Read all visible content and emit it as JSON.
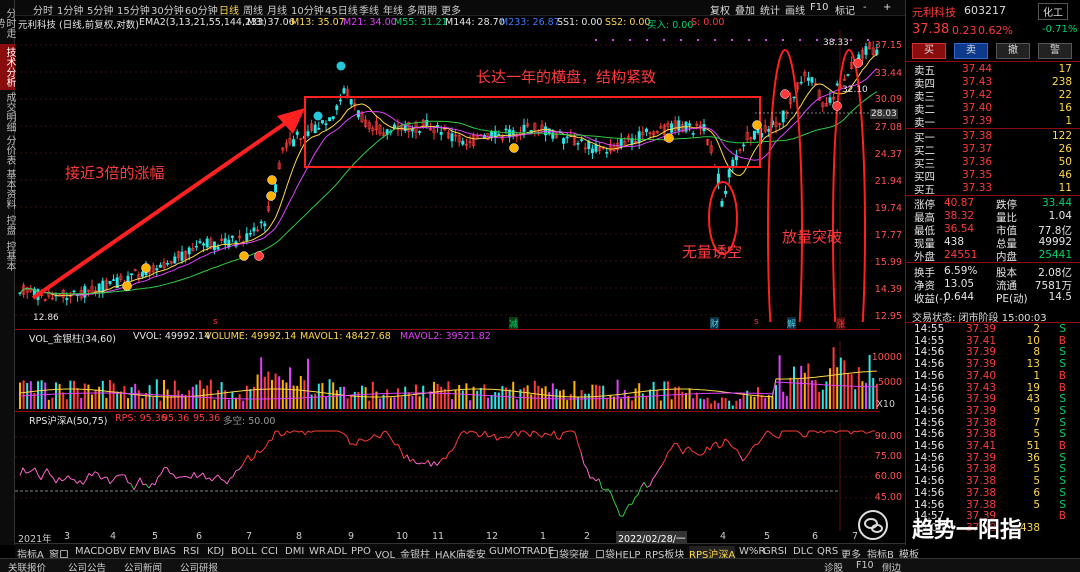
{
  "left_tabs": [
    "分时走势",
    "技术分析",
    "成交明细",
    "分价表",
    "基本资料",
    "控盘",
    "控基本"
  ],
  "toolbar": {
    "periods": [
      "分时",
      "1分钟",
      "5分钟",
      "15分钟",
      "30分钟",
      "60分钟",
      "日线",
      "周线",
      "月线",
      "10分钟",
      "45日线",
      "季线",
      "年线",
      "多周期",
      "更多"
    ],
    "right_items": [
      "复权",
      "叠加",
      "统计",
      "画线",
      "F10",
      "标记",
      "-",
      "+"
    ]
  },
  "main_header": {
    "stock": "元利科技 (日线,前复权,对数)",
    "ema": "EMA2(3,13,21,55,144,233)",
    "m3": "M3: 37.06",
    "m13": "M13: 35.07",
    "m21": "M21: 34.00",
    "m55": "M55: 31.21",
    "m144": "M144: 28.70",
    "m233": "M233: 26.87",
    "ss1": "SS1: 0.00",
    "ss2": "SS2: 0.00",
    "buy": "买入: 0.00",
    "s": "S: 0.00"
  },
  "price_axis": [
    "37.15",
    "33.44",
    "30.09",
    "27.08",
    "24.37",
    "21.94",
    "19.74",
    "17.77",
    "15.99",
    "14.39",
    "12.95"
  ],
  "price_labels": {
    "high": "38.33",
    "mid": "32.10",
    "current": "28.03",
    "low": "12.86"
  },
  "annotations": {
    "rally": "接近3倍的涨幅",
    "range": "长达一年的横盘，结构紧致",
    "dip": "无量诱空",
    "breakout": "放量突破"
  },
  "markers": [
    "s",
    "减",
    "财",
    "s",
    "解",
    "涨"
  ],
  "vol_header": {
    "name": "VOL_金银柱(34,60)",
    "vvol": "VVOL: 49992.14",
    "volume": "VOLUME: 49992.14",
    "mavol1": "MAVOL1: 48427.68",
    "mavol2": "MAVOL2: 39521.82"
  },
  "vol_axis": [
    "10000",
    "5000",
    "X10"
  ],
  "rps_header": {
    "name": "RPS沪深A(50,75)",
    "rps": "RPS: 95.36",
    "rps2": "95.36",
    "rps3": "95.36",
    "extra": "多空: 50.00"
  },
  "rps_axis": [
    "90.00",
    "75.00",
    "60.00",
    "45.00"
  ],
  "x_axis": [
    "2021年",
    "3",
    "4",
    "5",
    "6",
    "7",
    "8",
    "9",
    "10",
    "11",
    "12",
    "1",
    "2",
    "3",
    "4",
    "5",
    "6",
    "7"
  ],
  "x_date_highlight": "2022/02/28/一",
  "indicator_tabs": [
    "指标A",
    "窗口",
    "MACD",
    "OBV",
    "EMV",
    "BIAS",
    "RSI",
    "KDJ",
    "BOLL",
    "CCI",
    "DMI",
    "WR",
    "ADL",
    "PPO",
    "VOL_金银柱",
    "HAK庙委安",
    "GUMOTRADE",
    "口袋突破",
    "口袋HELP",
    "RPS板块",
    "RPS沪深A",
    "W%R",
    "GRSI",
    "DLC",
    "QRS",
    "更多",
    "指标B",
    "模板"
  ],
  "status_bar": [
    "关联报价",
    "公司公告",
    "公司新闻",
    "公司研报"
  ],
  "status_right": [
    "诊股",
    "F10",
    "侧边"
  ],
  "quote": {
    "name": "元利科技",
    "code": "603217",
    "sector": "化工",
    "sector_chg": "-0.71%",
    "price": "37.38",
    "change": "0.23",
    "pct": "0.62%",
    "buttons": [
      "买",
      "卖",
      "撤",
      "警"
    ],
    "asks": [
      [
        "卖五",
        "37.44",
        "17"
      ],
      [
        "卖四",
        "37.43",
        "238"
      ],
      [
        "卖三",
        "37.42",
        "22"
      ],
      [
        "卖二",
        "37.40",
        "16"
      ],
      [
        "卖一",
        "37.39",
        "1"
      ]
    ],
    "bids": [
      [
        "买一",
        "37.38",
        "122"
      ],
      [
        "买二",
        "37.37",
        "26"
      ],
      [
        "买三",
        "37.36",
        "50"
      ],
      [
        "买四",
        "37.35",
        "46"
      ],
      [
        "买五",
        "37.33",
        "11"
      ]
    ],
    "stats": [
      [
        "涨停",
        "40.87",
        "跌停",
        "33.44"
      ],
      [
        "最高",
        "38.32",
        "量比",
        "1.04"
      ],
      [
        "最低",
        "36.54",
        "市值",
        "77.8亿"
      ],
      [
        "现量",
        "438",
        "总量",
        "49992"
      ],
      [
        "外盘",
        "24551",
        "内盘",
        "25441"
      ],
      [
        "换手",
        "6.59%",
        "股本",
        "2.08亿"
      ],
      [
        "净资",
        "13.05",
        "流通",
        "7581万"
      ],
      [
        "收益(-)",
        "0.644",
        "PE(动)",
        "14.5"
      ]
    ],
    "trade_status": "交易状态: 闭市阶段 15:00:03",
    "ticks": [
      [
        "14:55",
        "37.39",
        "2",
        "S"
      ],
      [
        "14:55",
        "37.41",
        "10",
        "B"
      ],
      [
        "14:56",
        "37.39",
        "8",
        "S"
      ],
      [
        "14:56",
        "37.39",
        "13",
        "S"
      ],
      [
        "14:56",
        "37.40",
        "1",
        "B"
      ],
      [
        "14:56",
        "37.43",
        "19",
        "B"
      ],
      [
        "14:56",
        "37.39",
        "43",
        "S"
      ],
      [
        "14:56",
        "37.39",
        "9",
        "S"
      ],
      [
        "14:56",
        "37.38",
        "7",
        "S"
      ],
      [
        "14:56",
        "37.38",
        "5",
        "S"
      ],
      [
        "14:56",
        "37.41",
        "51",
        "B"
      ],
      [
        "14:56",
        "37.39",
        "36",
        "S"
      ],
      [
        "14:56",
        "37.38",
        "5",
        "S"
      ],
      [
        "14:56",
        "37.38",
        "5",
        "S"
      ],
      [
        "14:56",
        "37.38",
        "6",
        "S"
      ],
      [
        "14:56",
        "37.38",
        "5",
        "S"
      ],
      [
        "14:57",
        "37.39",
        "",
        "B"
      ],
      [
        "15:00",
        "37.38",
        "438",
        ""
      ]
    ]
  },
  "watermark": "趋势一阳指"
}
